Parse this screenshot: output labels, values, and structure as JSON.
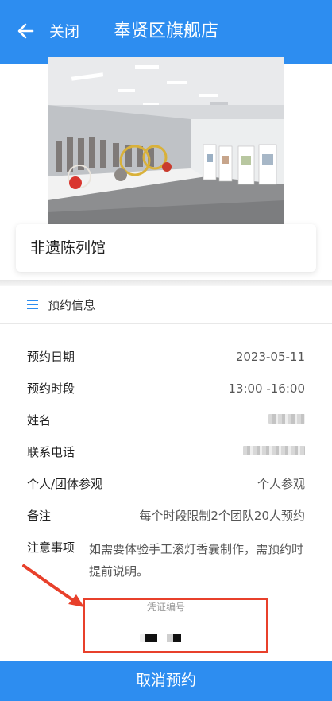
{
  "header": {
    "back_icon": "arrow-left-icon",
    "close_label": "关闭",
    "title": "奉贤区旗舰店"
  },
  "venue": {
    "name": "非遗陈列馆"
  },
  "section": {
    "icon": "menu-lines-icon",
    "title": "预约信息"
  },
  "details": [
    {
      "label": "预约日期",
      "value": "2023-05-11"
    },
    {
      "label": "预约时段",
      "value": "13:00 -16:00"
    },
    {
      "label": "姓名",
      "value": ""
    },
    {
      "label": "联系电话",
      "value": ""
    },
    {
      "label": "个人/团体参观",
      "value": "个人参观"
    },
    {
      "label": "备注",
      "value": "每个时段限制2个团队20人预约"
    }
  ],
  "notice": {
    "label": "注意事项",
    "text": "如需要体验手工滚灯香囊制作，需预约时提前说明。"
  },
  "voucher": {
    "label": "凭证编号"
  },
  "footer": {
    "cancel_label": "取消预约"
  },
  "colors": {
    "primary": "#2d8df0",
    "annotation": "#e8402b"
  }
}
